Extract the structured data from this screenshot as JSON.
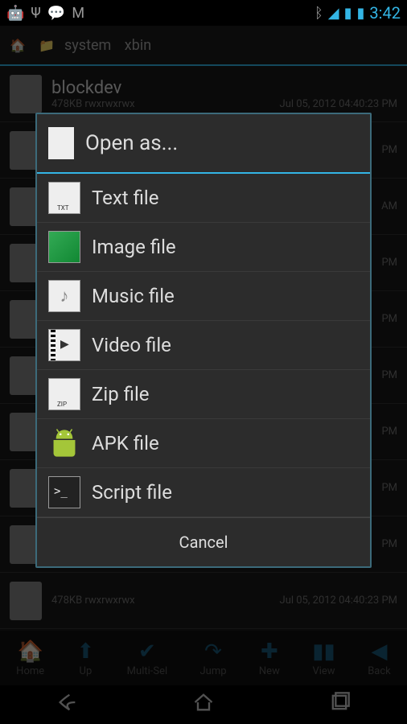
{
  "status_bar": {
    "clock": "3:42",
    "icons_left": [
      "android-icon",
      "usb-icon",
      "sms-icon",
      "gmail-icon"
    ],
    "icons_right": [
      "bluetooth-icon",
      "wifi-icon",
      "signal-icon",
      "battery-icon"
    ]
  },
  "header": {
    "breadcrumb": [
      "system",
      "xbin"
    ]
  },
  "file_list": [
    {
      "name": "blockdev",
      "size": "478KB",
      "perms": "rwxrwxrwx",
      "date": "Jul 05, 2012 04:40:23 PM"
    },
    {
      "name": "",
      "size": "",
      "perms": "",
      "date": "PM"
    },
    {
      "name": "",
      "size": "",
      "perms": "",
      "date": "AM"
    },
    {
      "name": "",
      "size": "",
      "perms": "",
      "date": "PM"
    },
    {
      "name": "",
      "size": "",
      "perms": "",
      "date": "PM"
    },
    {
      "name": "",
      "size": "",
      "perms": "",
      "date": "PM"
    },
    {
      "name": "",
      "size": "",
      "perms": "",
      "date": "PM"
    },
    {
      "name": "",
      "size": "",
      "perms": "",
      "date": "PM"
    },
    {
      "name": "",
      "size": "",
      "perms": "",
      "date": "PM"
    },
    {
      "name": "",
      "size": "478KB",
      "perms": "rwxrwxrwx",
      "date": "Jul 05, 2012 04:40:23 PM"
    }
  ],
  "dialog": {
    "title": "Open as...",
    "items": [
      {
        "label": "Text file",
        "icon": "txt-icon"
      },
      {
        "label": "Image file",
        "icon": "image-icon"
      },
      {
        "label": "Music file",
        "icon": "music-icon"
      },
      {
        "label": "Video file",
        "icon": "video-icon"
      },
      {
        "label": "Zip file",
        "icon": "zip-icon"
      },
      {
        "label": "APK file",
        "icon": "apk-icon"
      },
      {
        "label": "Script file",
        "icon": "script-icon"
      }
    ],
    "cancel": "Cancel"
  },
  "toolbar": [
    {
      "label": "Home",
      "icon": "home-icon"
    },
    {
      "label": "Up",
      "icon": "up-icon"
    },
    {
      "label": "Multi-Sel",
      "icon": "check-icon"
    },
    {
      "label": "Jump",
      "icon": "jump-icon"
    },
    {
      "label": "New",
      "icon": "plus-icon"
    },
    {
      "label": "View",
      "icon": "pause-icon"
    },
    {
      "label": "Back",
      "icon": "back-icon"
    }
  ],
  "navbar": [
    "back-nav",
    "home-nav",
    "recent-nav"
  ]
}
